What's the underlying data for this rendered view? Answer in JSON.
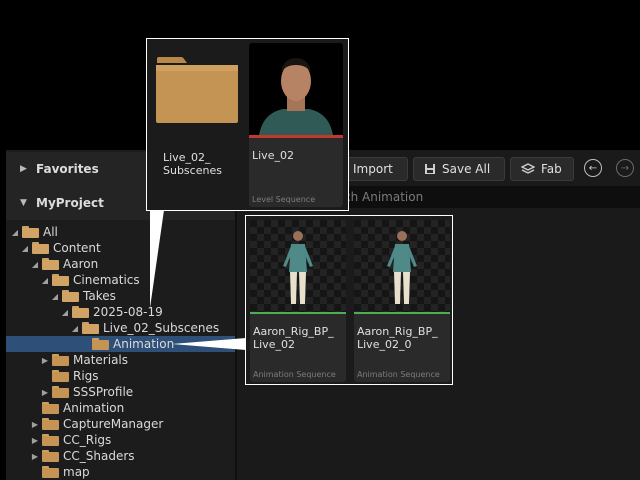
{
  "toolbar": {
    "import_label": "Import",
    "save_all_label": "Save All",
    "fab_label": "Fab"
  },
  "search": {
    "placeholder": "ch Animation"
  },
  "sections": {
    "favorites": "Favorites",
    "project": "MyProject"
  },
  "tree": [
    {
      "label": "All",
      "depth": 0,
      "caret": "open",
      "state": ""
    },
    {
      "label": "Content",
      "depth": 1,
      "caret": "open",
      "state": ""
    },
    {
      "label": "Aaron",
      "depth": 2,
      "caret": "open",
      "state": ""
    },
    {
      "label": "Cinematics",
      "depth": 3,
      "caret": "open",
      "state": ""
    },
    {
      "label": "Takes",
      "depth": 4,
      "caret": "open",
      "state": ""
    },
    {
      "label": "2025-08-19",
      "depth": 5,
      "caret": "open",
      "state": ""
    },
    {
      "label": "Live_02_Subscenes",
      "depth": 6,
      "caret": "open",
      "state": ""
    },
    {
      "label": "Animation",
      "depth": 7,
      "caret": "none",
      "state": "selected"
    },
    {
      "label": "Materials",
      "depth": 3,
      "caret": "closed",
      "state": ""
    },
    {
      "label": "Rigs",
      "depth": 3,
      "caret": "none",
      "state": ""
    },
    {
      "label": "SSSProfile",
      "depth": 3,
      "caret": "closed",
      "state": ""
    },
    {
      "label": "Animation",
      "depth": 2,
      "caret": "none",
      "state": ""
    },
    {
      "label": "CaptureManager",
      "depth": 2,
      "caret": "closed",
      "state": ""
    },
    {
      "label": "CC_Rigs",
      "depth": 2,
      "caret": "closed",
      "state": ""
    },
    {
      "label": "CC_Shaders",
      "depth": 2,
      "caret": "closed",
      "state": ""
    },
    {
      "label": "map",
      "depth": 2,
      "caret": "none",
      "state": ""
    }
  ],
  "popup_items": [
    {
      "name_line1": "Live_02_",
      "name_line2": "Subscenes",
      "type": ""
    },
    {
      "name_line1": "Live_02",
      "name_line2": "",
      "type": "Level Sequence"
    }
  ],
  "assets": [
    {
      "name_line1": "Aaron_Rig_BP_",
      "name_line2": "Live_02",
      "type": "Animation Sequence"
    },
    {
      "name_line1": "Aaron_Rig_BP_",
      "name_line2": "Live_02_0",
      "type": "Animation Sequence"
    }
  ],
  "colors": {
    "selected_row": "#2d4f78",
    "folder": "#c49454",
    "level_sequence_bar": "#c0392b",
    "animation_bar": "#4caf50"
  }
}
